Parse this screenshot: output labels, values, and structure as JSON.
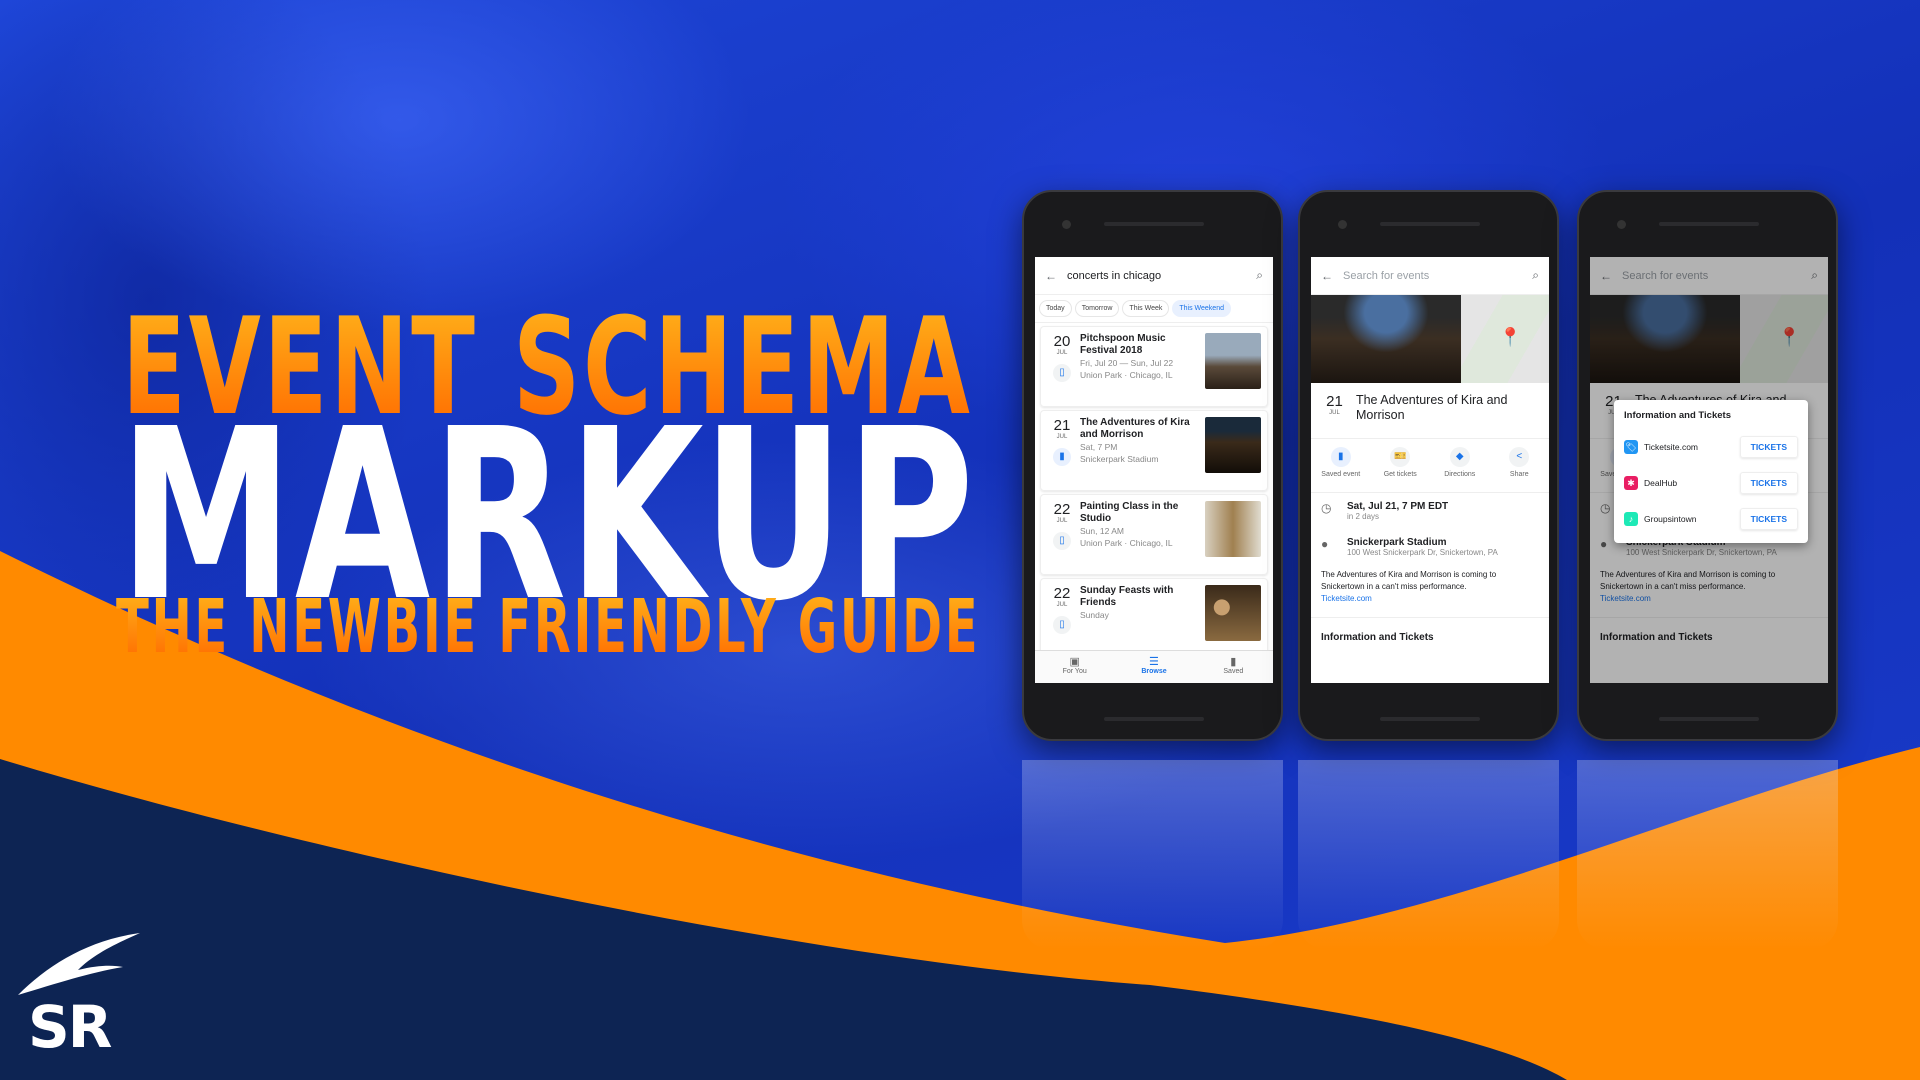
{
  "colors": {
    "background_blue": "#1637c4",
    "orange": "#ff8a00",
    "navy": "#0d2453",
    "link_blue": "#1a73e8"
  },
  "headline": {
    "line1": "EVENT SCHEMA",
    "line2": "MARKUP",
    "line3": "THE NEWBIE FRIENDLY GUIDE"
  },
  "logo": {
    "text": "SR"
  },
  "phone1": {
    "search_query": "concerts in chicago",
    "chips": [
      {
        "label": "Today"
      },
      {
        "label": "Tomorrow"
      },
      {
        "label": "This Week"
      },
      {
        "label": "This Weekend",
        "selected": true
      }
    ],
    "events": [
      {
        "day": "20",
        "month": "JUL",
        "title": "Pitchspoon Music Festival 2018",
        "line1": "Fri, Jul 20 — Sun, Jul 22",
        "line2": "Union Park · Chicago, IL",
        "saved": false
      },
      {
        "day": "21",
        "month": "JUL",
        "title": "The Adventures of Kira and Morrison",
        "line1": "Sat, 7 PM",
        "line2": "Snickerpark Stadium",
        "saved": true
      },
      {
        "day": "22",
        "month": "JUL",
        "title": "Painting Class in the Studio",
        "line1": "Sun, 12 AM",
        "line2": "Union Park · Chicago, IL",
        "saved": false
      },
      {
        "day": "22",
        "month": "JUL",
        "title": "Sunday Feasts with Friends",
        "line1": "Sunday",
        "line2": "",
        "saved": false
      }
    ],
    "nav": [
      {
        "label": "For You",
        "icon": "for-you-icon"
      },
      {
        "label": "Browse",
        "icon": "list-icon",
        "active": true
      },
      {
        "label": "Saved",
        "icon": "bookmark-icon"
      }
    ]
  },
  "detail": {
    "search_placeholder": "Search for events",
    "day": "21",
    "month": "JUL",
    "title": "The Adventures of Kira and Morrison",
    "actions": [
      {
        "label": "Saved event",
        "icon": "bookmark-icon"
      },
      {
        "label": "Get tickets",
        "icon": "ticket-icon"
      },
      {
        "label": "Directions",
        "icon": "directions-icon"
      },
      {
        "label": "Share",
        "icon": "share-icon"
      }
    ],
    "datetime": "Sat, Jul 21, 7 PM EDT",
    "relative": "in 2 days",
    "venue": "Snickerpark Stadium",
    "address": "100 West Snickerpark Dr, Snickertown, PA",
    "description": "The Adventures of Kira and Morrison is coming to Snickertown in a can't miss performance.",
    "link": "Ticketsite.com",
    "info_heading": "Information and Tickets"
  },
  "dialog": {
    "title": "Information and Tickets",
    "providers": [
      {
        "name": "Ticketsite.com",
        "button": "TICKETS",
        "color": "#2196f3"
      },
      {
        "name": "DealHub",
        "button": "TICKETS",
        "color": "#e91e63"
      },
      {
        "name": "Groupsintown",
        "button": "TICKETS",
        "color": "#1de9b6"
      }
    ]
  }
}
